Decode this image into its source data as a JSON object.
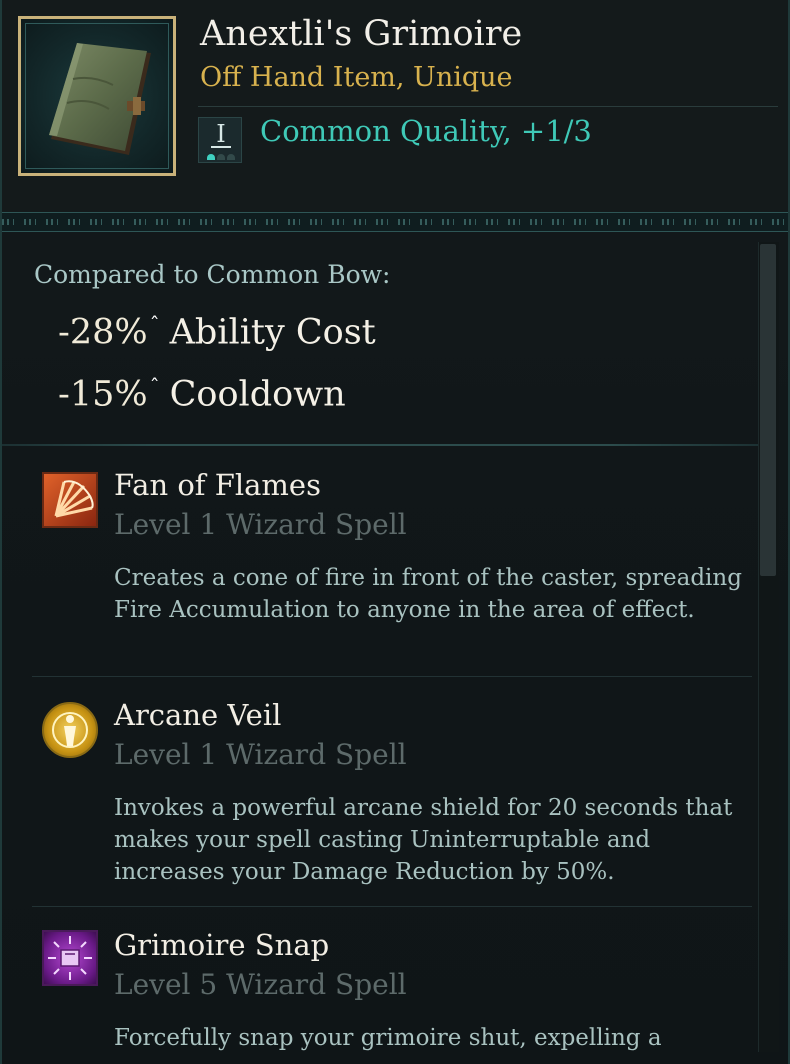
{
  "item": {
    "name": "Anextli's Grimoire",
    "type": "Off Hand Item, Unique",
    "tier_numeral": "I",
    "quality": "Common Quality, +1/3",
    "icon": "grimoire-book-icon"
  },
  "comparison": {
    "label": "Compared to Common Bow:",
    "stats": [
      {
        "value": "-28%",
        "arrow": "ˆ",
        "label": "Ability Cost"
      },
      {
        "value": "-15%",
        "arrow": "ˆ",
        "label": "Cooldown"
      }
    ]
  },
  "spells": [
    {
      "name": "Fan of Flames",
      "level": "Level 1 Wizard Spell",
      "description": "Creates a cone of fire in front of the caster, spreading Fire Accumulation to anyone in the area of effect.",
      "icon": "fan-of-flames-icon",
      "color": "#c8461e"
    },
    {
      "name": "Arcane Veil",
      "level": "Level 1 Wizard Spell",
      "description": "Invokes a powerful arcane shield for 20 seconds that makes your spell casting Uninterruptable and increases your Damage Reduction by 50%.",
      "icon": "arcane-veil-icon",
      "color": "#d6a81e"
    },
    {
      "name": "Grimoire Snap",
      "level": "Level 5 Wizard Spell",
      "description": "Forcefully snap your grimoire shut, expelling a",
      "icon": "grimoire-snap-icon",
      "color": "#8a2aa6"
    }
  ],
  "colors": {
    "gold": "#d8b24e",
    "teal": "#3fc9b7",
    "frame": "#c9b27a"
  }
}
